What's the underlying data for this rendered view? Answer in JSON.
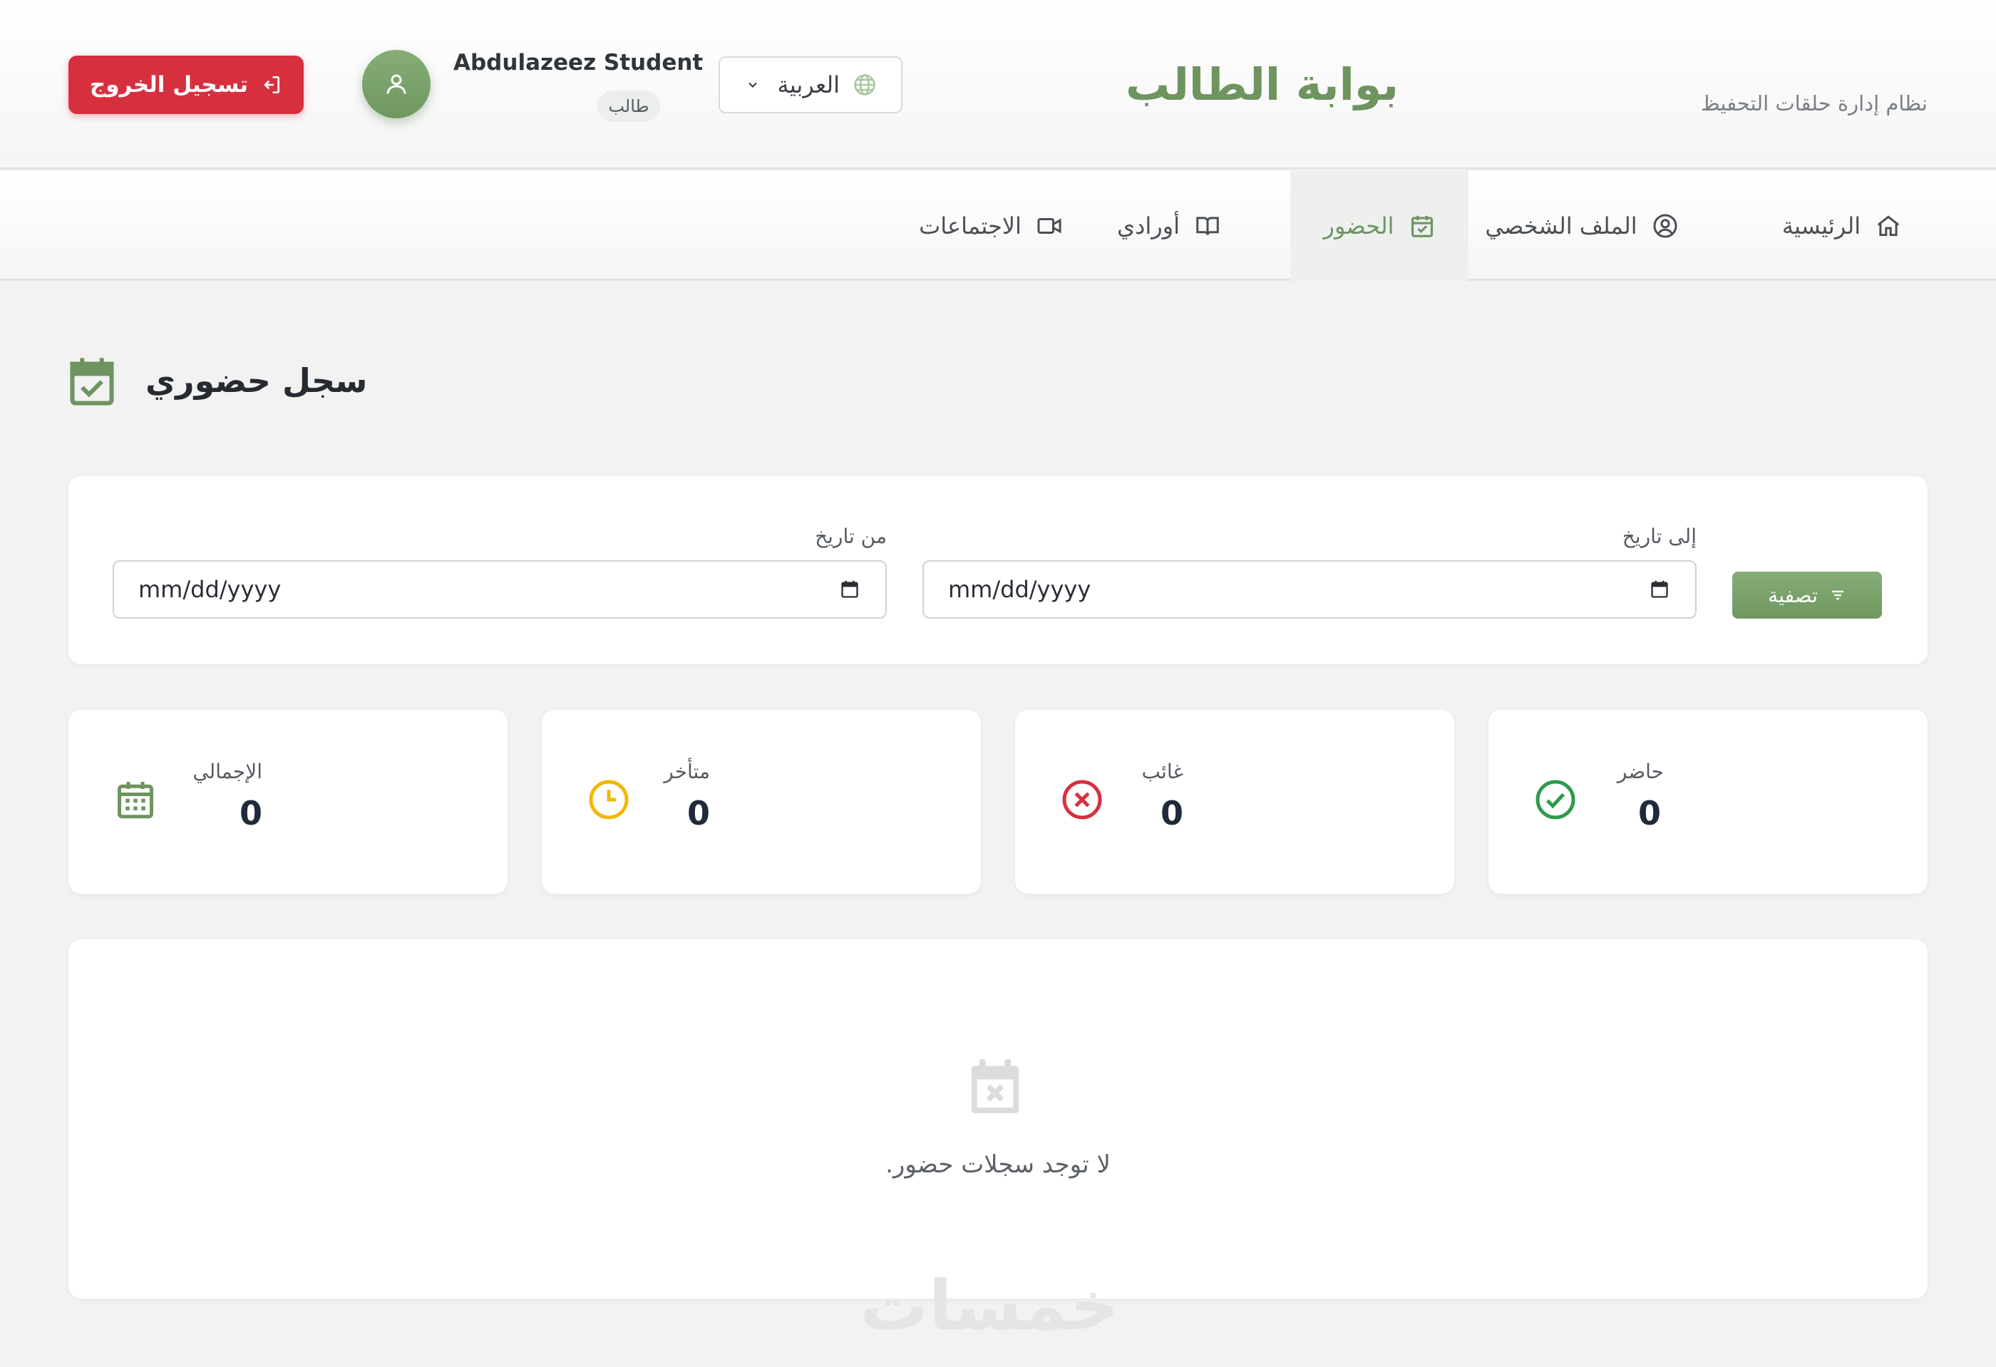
{
  "header": {
    "title": "بوابة الطالب",
    "subtitle": "نظام إدارة حلقات التحفيظ",
    "language": "العربية",
    "user_name": "Abdulazeez Student",
    "user_role": "طالب",
    "logout_label": "تسجيل الخروج"
  },
  "nav": {
    "tabs": [
      {
        "label": "الرئيسية",
        "icon": "home-icon"
      },
      {
        "label": "الملف الشخصي",
        "icon": "user-circle-icon"
      },
      {
        "label": "الحضور",
        "icon": "calendar-check-icon",
        "active": true
      },
      {
        "label": "أورادي",
        "icon": "book-open-icon"
      },
      {
        "label": "الاجتماعات",
        "icon": "video-icon"
      }
    ]
  },
  "page": {
    "title": "سجل حضوري",
    "title_icon": "calendar-check-icon"
  },
  "filter": {
    "from_label": "من تاريخ",
    "to_label": "إلى تاريخ",
    "from_value": "mm/dd/yyyy",
    "to_value": "mm/dd/yyyy",
    "button_label": "تصفية"
  },
  "stats": [
    {
      "label": "حاضر",
      "value": "0",
      "icon": "check-circle-icon",
      "color": "#2e9a4a"
    },
    {
      "label": "غائب",
      "value": "0",
      "icon": "x-circle-icon",
      "color": "#d6303f"
    },
    {
      "label": "متأخر",
      "value": "0",
      "icon": "clock-icon",
      "color": "#f2b705"
    },
    {
      "label": "الإجمالي",
      "value": "0",
      "icon": "calendar-grid-icon",
      "color": "#6e9460"
    }
  ],
  "empty_state": {
    "message": "لا توجد سجلات حضور.",
    "icon": "calendar-x-icon"
  },
  "watermark": "خمسات",
  "colors": {
    "brand": "#6e9460",
    "danger": "#d6303f",
    "background": "#f2f2f2"
  }
}
